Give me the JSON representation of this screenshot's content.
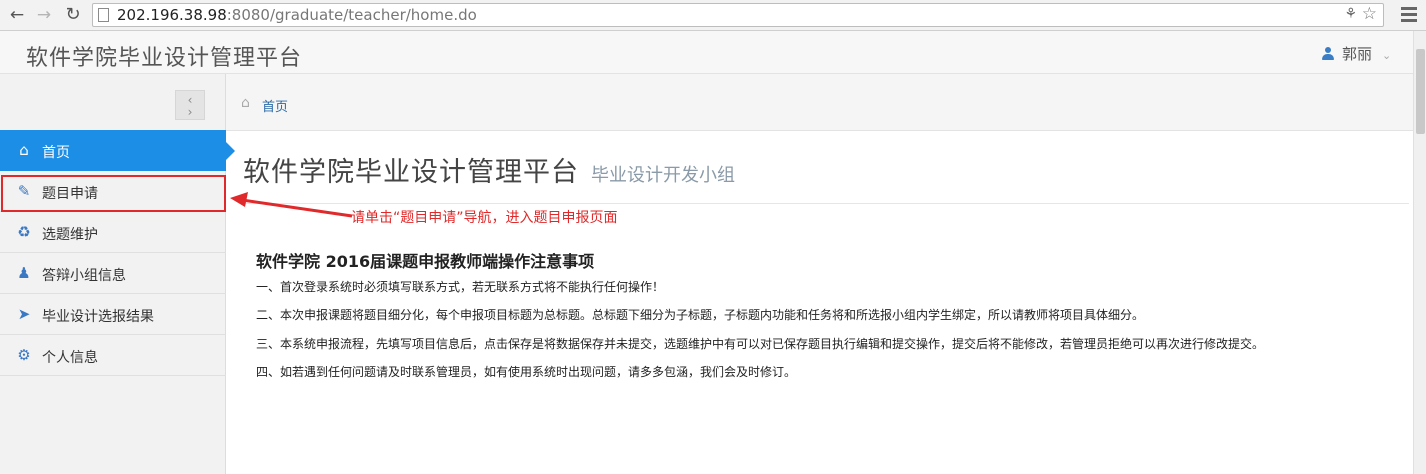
{
  "browser": {
    "url_host": "202.196.38.98",
    "url_path": ":8080/graduate/teacher/home.do"
  },
  "header": {
    "brand": "软件学院毕业设计管理平台",
    "user_name": "郭丽"
  },
  "sidebar": {
    "items": [
      {
        "label": "首页",
        "icon": "home-icon"
      },
      {
        "label": "题目申请",
        "icon": "edit-icon"
      },
      {
        "label": "选题维护",
        "icon": "maintain-icon"
      },
      {
        "label": "答辩小组信息",
        "icon": "users-icon"
      },
      {
        "label": "毕业设计选报结果",
        "icon": "pointer-icon"
      },
      {
        "label": "个人信息",
        "icon": "gear-icon"
      }
    ]
  },
  "breadcrumb": {
    "home": "首页"
  },
  "main": {
    "title": "软件学院毕业设计管理平台",
    "subtitle": "毕业设计开发小组",
    "annotation": "请单击“题目申请”导航，进入题目申报页面",
    "notice": {
      "heading": "软件学院  2016届课题申报教师端操作注意事项",
      "lines": [
        "一、首次登录系统时必须填写联系方式，若无联系方式将不能执行任何操作！",
        "二、本次申报课题将题目细分化，每个申报项目标题为总标题。总标题下细分为子标题，子标题内功能和任务将和所选报小组内学生绑定，所以请教师将项目具体细分。",
        "三、本系统申报流程，先填写项目信息后，点击保存是将数据保存并未提交，选题维护中有可以对已保存题目执行编辑和提交操作，提交后将不能修改，若管理员拒绝可以再次进行修改提交。",
        "四、如若遇到任何问题请及时联系管理员，如有使用系统时出现问题，请多多包涵，我们会及时修订。"
      ]
    }
  },
  "colors": {
    "active_nav": "#1c8ee6",
    "annotation_red": "#e0292a",
    "link_blue": "#2a6aa8"
  }
}
